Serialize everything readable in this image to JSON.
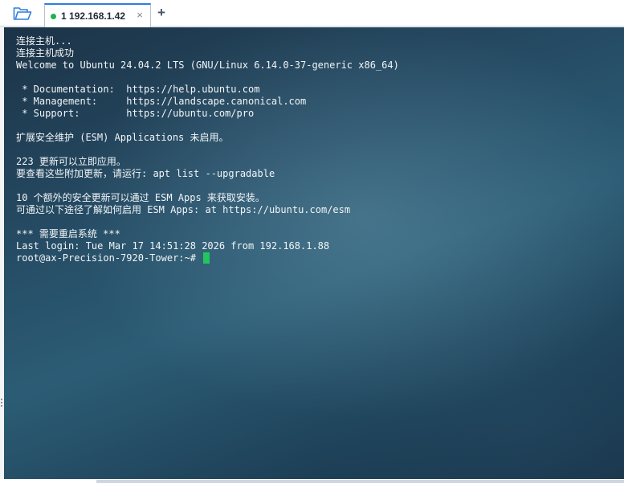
{
  "toolbar": {
    "open_folder_icon": "folder-open-icon"
  },
  "tabs": [
    {
      "number": "1",
      "host": "192.168.1.42",
      "status_color": "#22b14c",
      "close_glyph": "×"
    }
  ],
  "new_tab_glyph": "+",
  "terminal": {
    "lines": [
      "连接主机...",
      "连接主机成功",
      "Welcome to Ubuntu 24.04.2 LTS (GNU/Linux 6.14.0-37-generic x86_64)",
      "",
      " * Documentation:  https://help.ubuntu.com",
      " * Management:     https://landscape.canonical.com",
      " * Support:        https://ubuntu.com/pro",
      "",
      "扩展安全维护 (ESM) Applications 未启用。",
      "",
      "223 更新可以立即应用。",
      "要查看这些附加更新，请运行: apt list --upgradable",
      "",
      "10 个额外的安全更新可以通过 ESM Apps 来获取安装。",
      "可通过以下途径了解如何启用 ESM Apps: at https://ubuntu.com/esm",
      "",
      "*** 需要重启系统 ***",
      "Last login: Tue Mar 17 14:51:28 2026 from 192.168.1.88"
    ],
    "prompt": "root@ax-Precision-7920-Tower:~# ",
    "cursor_color": "#22c55e",
    "text_color": "#f2f5f7"
  },
  "colors": {
    "tab_accent": "#2f7de1",
    "connected_dot": "#22b14c"
  }
}
